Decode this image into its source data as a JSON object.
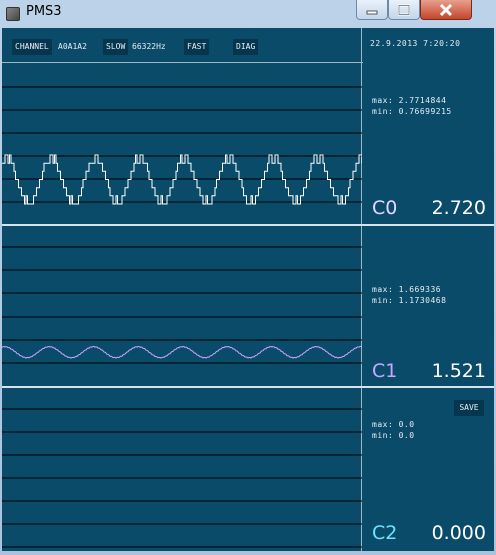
{
  "window": {
    "title": "PMS3"
  },
  "toolbar": {
    "channel_label": "CHANNEL",
    "channels": "A0A1A2",
    "slow_label": "SLOW",
    "rate": "66322Hz",
    "fast_label": "FAST",
    "diag_label": "DIAG"
  },
  "datetime": "22.9.2013 7:20:20",
  "channels": [
    {
      "max": "max: 2.7714844",
      "min": "min: 0.76699215",
      "label": "C0",
      "value": "2.720",
      "color": "#ffffff"
    },
    {
      "max": "max: 1.669336",
      "min": "min: 1.1730468",
      "label": "C1",
      "value": "1.521",
      "color": "#c9a6ff"
    },
    {
      "max": "max: 0.0",
      "min": "min: 0.0",
      "label": "C2",
      "value": "0.000",
      "color": "#6fe0ff"
    }
  ],
  "save_label": "SAVE",
  "colors": {
    "background": "#0a4b6a",
    "button": "#06364d",
    "trace0": "#ffffff",
    "trace1": "#c9a6ff",
    "trace2": "#6fe0ff"
  }
}
